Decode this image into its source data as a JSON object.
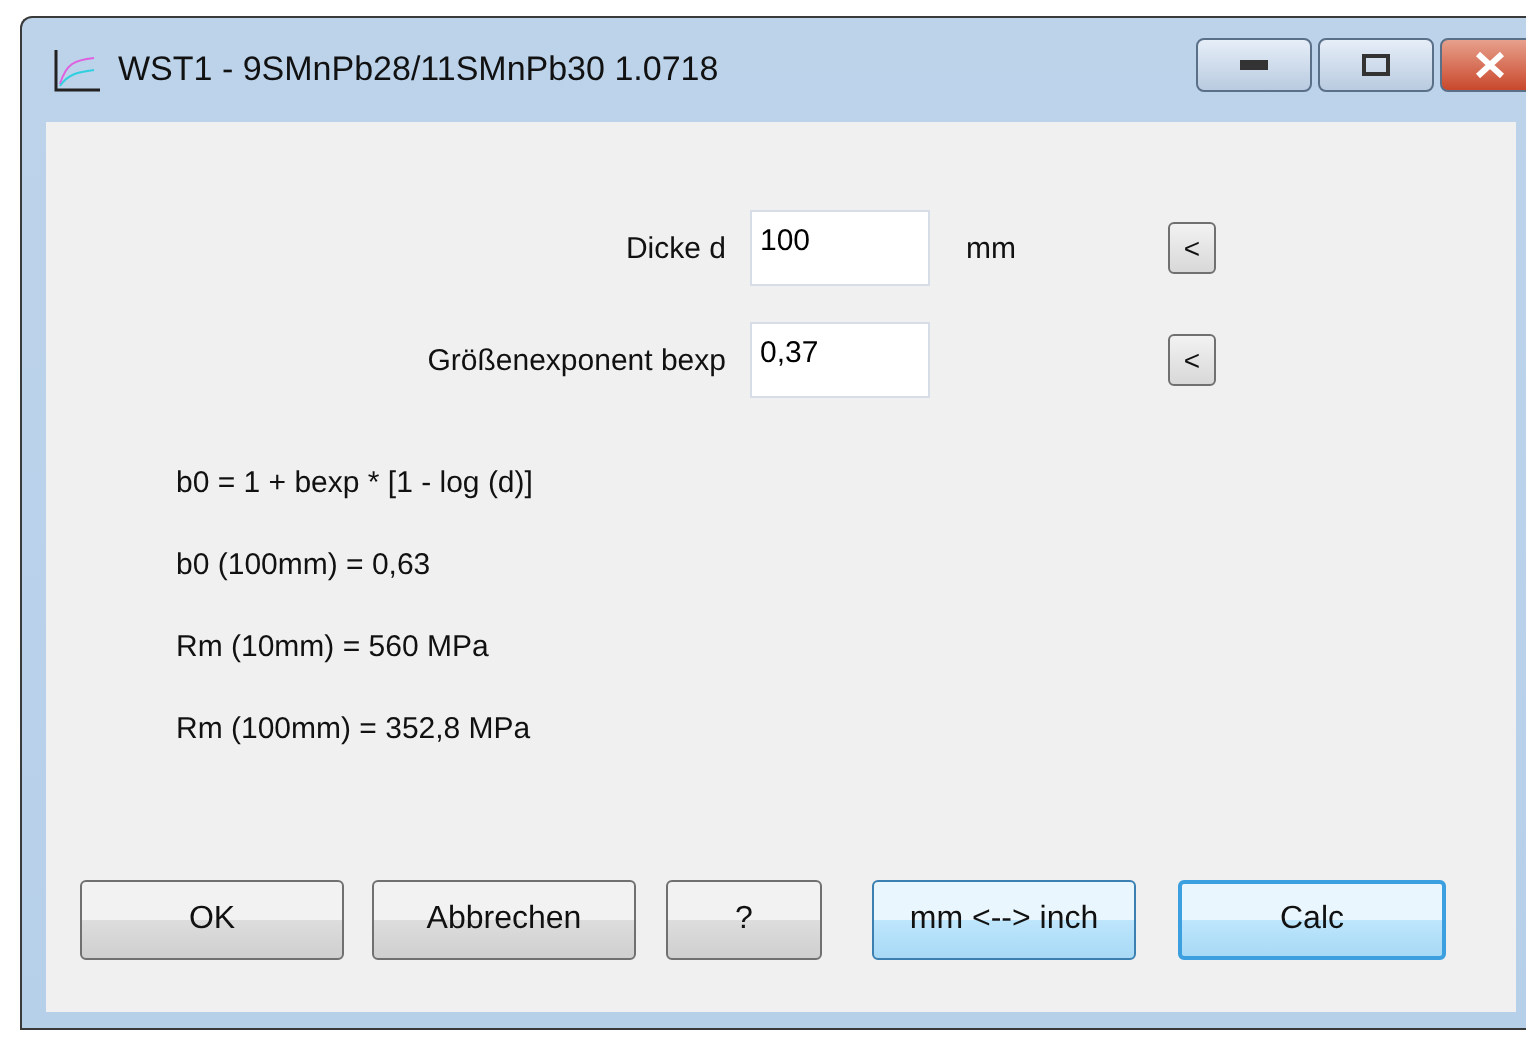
{
  "window": {
    "title": "WST1 - 9SMnPb28/11SMnPb30 1.0718"
  },
  "fields": [
    {
      "label": "Dicke d",
      "value": "100",
      "unit": "mm",
      "button": "<"
    },
    {
      "label": "Größenexponent bexp",
      "value": "0,37",
      "button": "<"
    }
  ],
  "results": [
    "b0 = 1 + bexp * [1 - log (d)]",
    "b0 (100mm) = 0,63",
    "Rm (10mm) = 560 MPa",
    "Rm (100mm) = 352,8 MPa"
  ],
  "buttons": [
    {
      "label": "OK",
      "kind": "normal"
    },
    {
      "label": "Abbrechen",
      "kind": "normal"
    },
    {
      "label": "?",
      "kind": "narrow"
    },
    {
      "label": "mm <--> inch",
      "kind": "hot"
    },
    {
      "label": "Calc",
      "kind": "default"
    }
  ]
}
